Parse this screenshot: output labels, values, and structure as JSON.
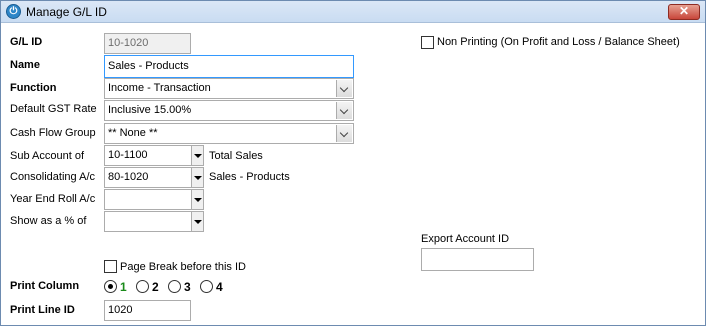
{
  "window": {
    "title": "Manage G/L ID",
    "close_glyph": "✕"
  },
  "fields": {
    "gl_id": {
      "label": "G/L ID",
      "value": "10-1020"
    },
    "name": {
      "label": "Name",
      "value": "Sales - Products"
    },
    "function": {
      "label": "Function",
      "value": "Income - Transaction"
    },
    "gst_rate": {
      "label": "Default GST Rate",
      "value": "Inclusive 15.00%"
    },
    "cash_flow": {
      "label": "Cash Flow Group",
      "value": "** None **"
    },
    "sub_account": {
      "label": "Sub Account of",
      "value": "10-1100",
      "description": "Total Sales"
    },
    "consolidating": {
      "label": "Consolidating A/c",
      "value": "80-1020",
      "description": "Sales - Products"
    },
    "year_end_roll": {
      "label": "Year End Roll A/c",
      "value": ""
    },
    "show_as_percent": {
      "label": "Show as a % of",
      "value": ""
    },
    "print_line_id": {
      "label": "Print Line ID",
      "value": "1020"
    },
    "export_account_id": {
      "label": "Export Account ID",
      "value": ""
    }
  },
  "checkboxes": {
    "non_printing": {
      "label": "Non Printing (On Profit and Loss / Balance Sheet)",
      "checked": false
    },
    "page_break": {
      "label": "Page Break before this ID",
      "checked": false
    }
  },
  "print_column": {
    "label": "Print Column",
    "options": [
      "1",
      "2",
      "3",
      "4"
    ],
    "selected": "1"
  }
}
